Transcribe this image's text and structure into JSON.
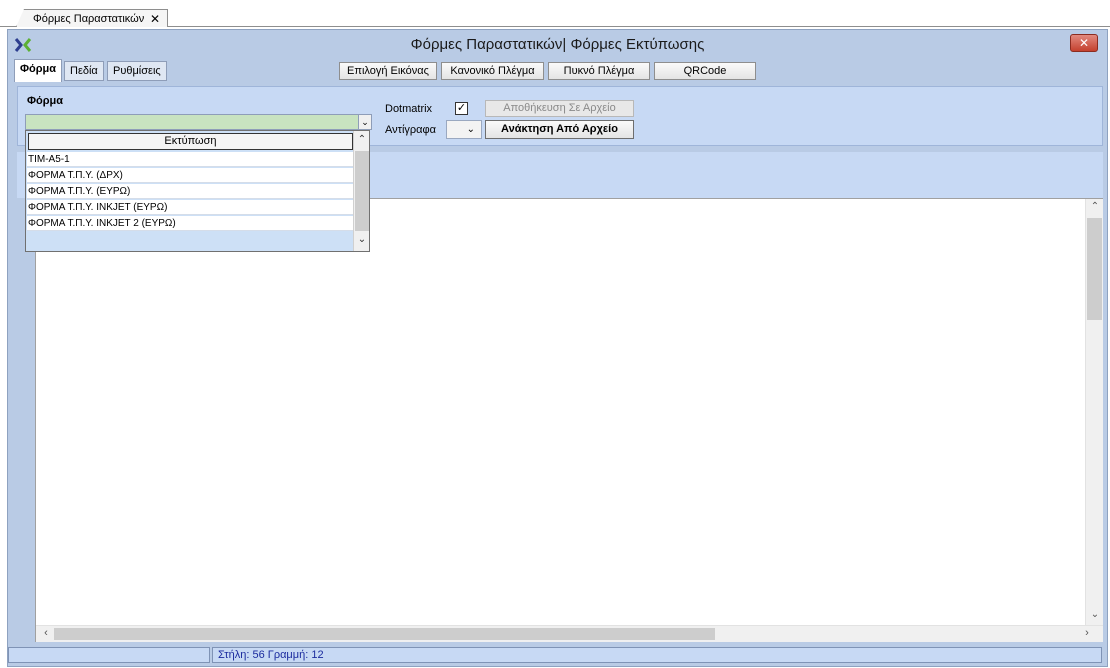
{
  "doc_tab": {
    "label": "Φόρμες Παραστατικών",
    "close_glyph": "✕"
  },
  "window": {
    "title": "Φόρμες Παραστατικών| Φόρμες Εκτύπωσης",
    "close_glyph": "✕"
  },
  "form_tabs": [
    {
      "label": "Φόρμα",
      "active": true
    },
    {
      "label": "Πεδία",
      "active": false
    },
    {
      "label": "Ρυθμίσεις",
      "active": false
    }
  ],
  "toolbar": {
    "choose_image": "Επιλογή Εικόνας",
    "normal_grid": "Κανονικό Πλέγμα",
    "dense_grid": "Πυκνό Πλέγμα",
    "qrcode": "QRCode"
  },
  "form_panel": {
    "forma_label": "Φόρμα",
    "dotmatrix_label": "Dotmatrix",
    "dotmatrix_checked": true,
    "copies_label": "Αντίγραφα",
    "save_to_file": "Αποθήκευση Σε Αρχείο",
    "load_from_file": "Ανάκτηση Από Αρχείο"
  },
  "dropdown": {
    "header": "Εκτύπωση",
    "items": [
      "TIM-A5-1",
      "ΦΟΡΜΑ Τ.Π.Υ. (ΔΡΧ)",
      "ΦΟΡΜΑ Τ.Π.Υ. (ΕΥΡΩ)",
      "ΦΟΡΜΑ Τ.Π.Υ. INKJET (ΕΥΡΩ)",
      "ΦΟΡΜΑ Τ.Π.Υ. INKJET 2 (ΕΥΡΩ)"
    ]
  },
  "status": {
    "position_text": "Στήλη: 56  Γραμμή: 12"
  },
  "colors": {
    "panel": "#c7d9f4",
    "window": "#b9cbe5",
    "combo": "#c8e3c0",
    "status_text": "#1b2b9e"
  },
  "icons": {
    "chevron_down": "⌄",
    "chevron_up": "⌃",
    "chevron_left": "‹",
    "chevron_right": "›"
  }
}
